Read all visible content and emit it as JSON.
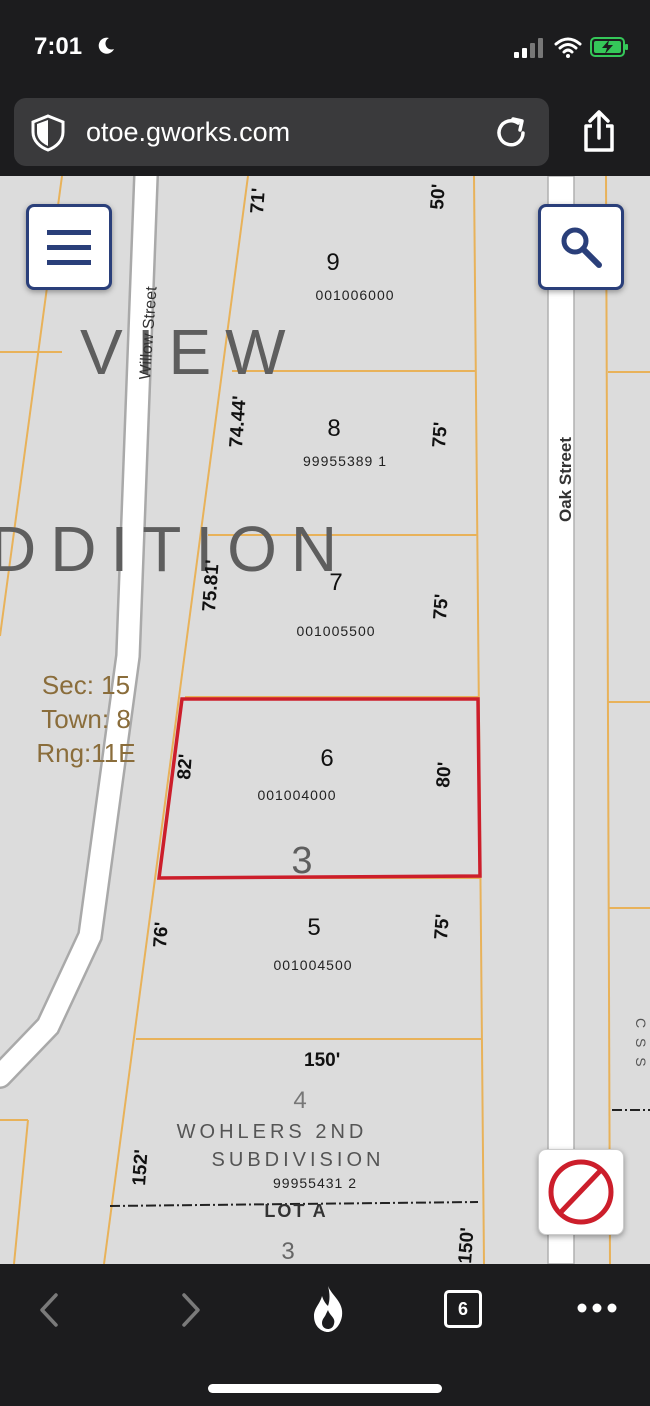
{
  "status_bar": {
    "time": "7:01"
  },
  "address_bar": {
    "url": "otoe.gworks.com"
  },
  "map": {
    "subdivision_words": [
      "VIEW",
      "DDITION"
    ],
    "street_labels": {
      "willow": "Willow Street",
      "oak": "Oak Street"
    },
    "section_info": [
      "Sec: 15",
      "Town: 8",
      "Rng:11E"
    ],
    "parcels": [
      {
        "lot": "9",
        "id": "001006000"
      },
      {
        "lot": "8",
        "id": "99955389 1"
      },
      {
        "lot": "7",
        "id": "001005500"
      },
      {
        "lot": "6",
        "id": "001004000"
      },
      {
        "lot": "5",
        "id": "001004500"
      }
    ],
    "dimensions": {
      "top_left": "71'",
      "top_right": "50'",
      "p8_left": "74.44'",
      "p8_right": "75'",
      "p7_left": "75.81'",
      "p7_right": "75'",
      "p6_left": "82'",
      "p6_right": "80'",
      "p5_left": "76'",
      "p5_right": "75'",
      "lower_top": "150'",
      "lower_left": "152'",
      "lower_right": "150'"
    },
    "block_number": "3",
    "lower_block_number": "4",
    "lower_block_bottom": "3",
    "wohlers_lines": [
      "WOHLERS 2ND",
      "SUBDIVISION"
    ],
    "wohlers_id": "99955431 2",
    "lot_a": "LOT A",
    "edge_letters": "C S S",
    "selected_parcel_color": "#cc1e2b"
  },
  "browser_toolbar": {
    "tab_count": "6"
  }
}
